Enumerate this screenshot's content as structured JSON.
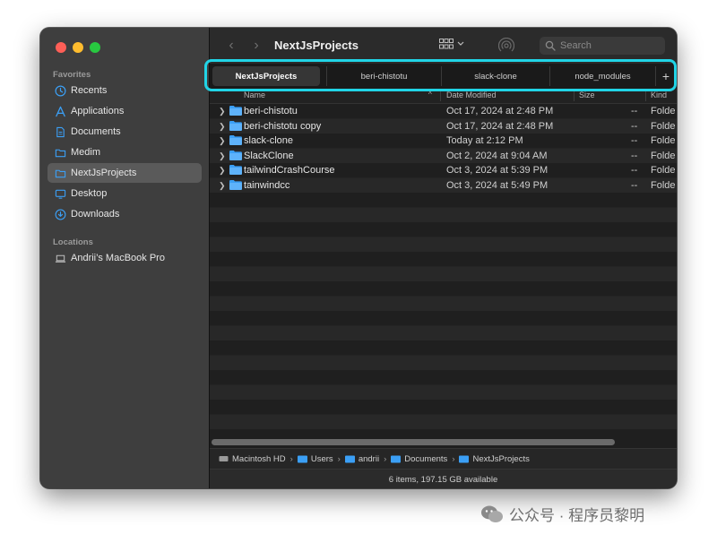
{
  "window": {
    "title": "NextJsProjects"
  },
  "sidebar": {
    "favorites_title": "Favorites",
    "locations_title": "Locations",
    "items": [
      {
        "label": "Recents",
        "icon": "clock-icon"
      },
      {
        "label": "Applications",
        "icon": "applications-icon"
      },
      {
        "label": "Documents",
        "icon": "document-icon"
      },
      {
        "label": "Medim",
        "icon": "folder-icon"
      },
      {
        "label": "NextJsProjects",
        "icon": "folder-icon",
        "active": true
      },
      {
        "label": "Desktop",
        "icon": "desktop-icon"
      },
      {
        "label": "Downloads",
        "icon": "download-icon"
      }
    ],
    "locations": [
      {
        "label": "Andrii’s MacBook Pro",
        "icon": "laptop-icon"
      }
    ]
  },
  "toolbar": {
    "back": "‹",
    "forward": "›",
    "search_placeholder": "Search"
  },
  "tabs": [
    {
      "label": "NextJsProjects",
      "active": true
    },
    {
      "label": "beri-chistotu"
    },
    {
      "label": "slack-clone"
    },
    {
      "label": "node_modules"
    }
  ],
  "tab_add": "+",
  "columns": {
    "name": "Name",
    "date": "Date Modified",
    "size": "Size",
    "kind": "Kind"
  },
  "files": [
    {
      "name": "beri-chistotu",
      "date": "Oct 17, 2024 at 2:48 PM",
      "size": "--",
      "kind": "Folde"
    },
    {
      "name": "beri-chistotu copy",
      "date": "Oct 17, 2024 at 2:48 PM",
      "size": "--",
      "kind": "Folde"
    },
    {
      "name": "slack-clone",
      "date": "Today at 2:12 PM",
      "size": "--",
      "kind": "Folde"
    },
    {
      "name": "SlackClone",
      "date": "Oct 2, 2024 at 9:04 AM",
      "size": "--",
      "kind": "Folde"
    },
    {
      "name": "tailwindCrashCourse",
      "date": "Oct 3, 2024 at 5:39 PM",
      "size": "--",
      "kind": "Folde"
    },
    {
      "name": "tainwindcc",
      "date": "Oct 3, 2024 at 5:49 PM",
      "size": "--",
      "kind": "Folde"
    }
  ],
  "path": [
    "Macintosh HD",
    "Users",
    "andrii",
    "Documents",
    "NextJsProjects"
  ],
  "path_sep": "›",
  "status": "6 items, 197.15 GB available",
  "watermark": "公众号 · 程序员黎明",
  "colors": {
    "accent_highlight": "#21d4e6",
    "folder": "#3b9ff5",
    "sidebar_icon": "#3b9ff5"
  }
}
